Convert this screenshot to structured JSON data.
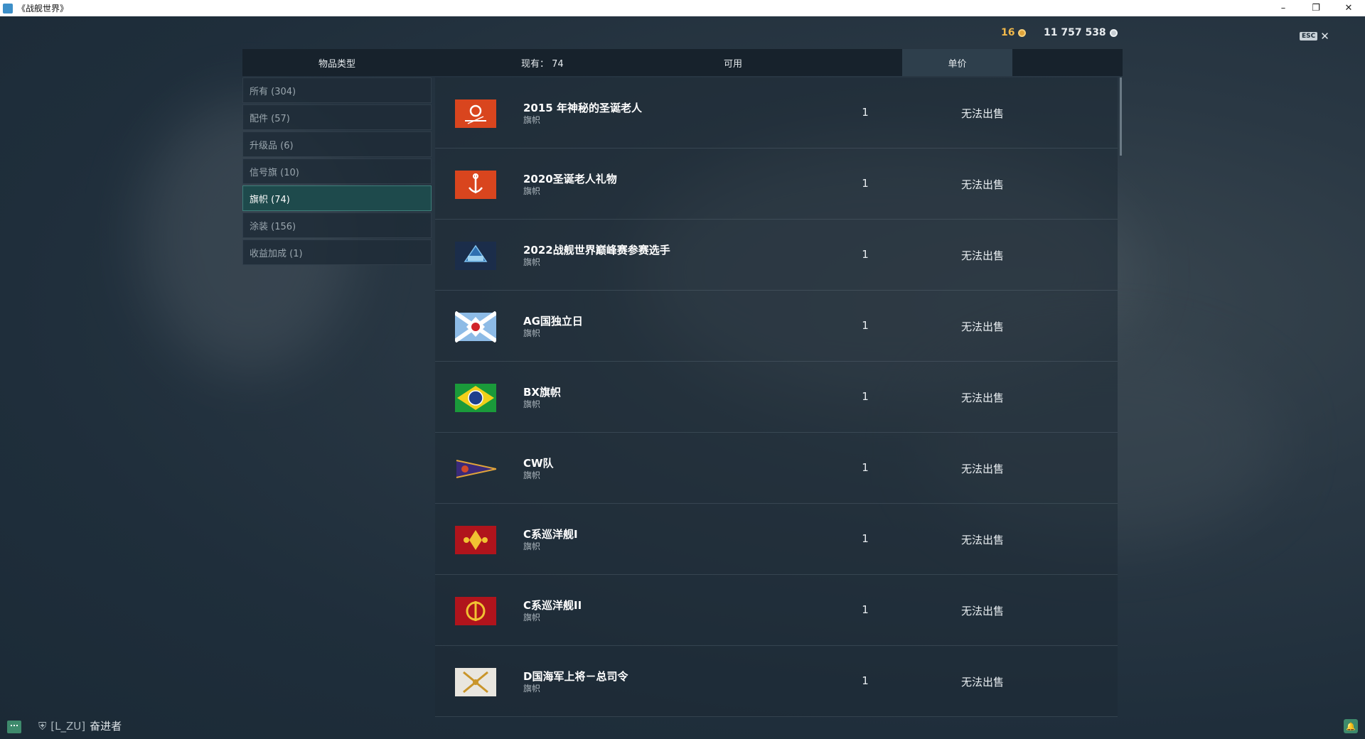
{
  "window": {
    "title": "《战舰世界》",
    "controls": [
      "–",
      "❐",
      "✕"
    ]
  },
  "currencies": [
    {
      "value": "16",
      "icon": "gold-doubloon-icon",
      "color": "#f0b84a"
    },
    {
      "value": "11 757 538",
      "icon": "silver-credits-icon",
      "color": "#e6ebee"
    }
  ],
  "esc": {
    "key": "ESC",
    "close": "✕"
  },
  "header": {
    "type_label": "物品类型",
    "have_label": "现有：  74",
    "available_label": "可用",
    "price_label": "单价"
  },
  "sidebar": {
    "items": [
      {
        "label": "所有 (304)",
        "active": false
      },
      {
        "label": "配件 (57)",
        "active": false
      },
      {
        "label": "升级品 (6)",
        "active": false
      },
      {
        "label": "信号旗 (10)",
        "active": false
      },
      {
        "label": "旗帜 (74)",
        "active": true
      },
      {
        "label": "涂装 (156)",
        "active": false
      },
      {
        "label": "收益加成 (1)",
        "active": false
      }
    ]
  },
  "rows": [
    {
      "name": "2015 年神秘的圣诞老人",
      "category": "旗帜",
      "available": "1",
      "price": "无法出售",
      "flag": "santa-2015-flag-icon",
      "flag_color": "#d9451e"
    },
    {
      "name": "2020圣诞老人礼物",
      "category": "旗帜",
      "available": "1",
      "price": "无法出售",
      "flag": "santa-2020-flag-icon",
      "flag_color": "#d9451e"
    },
    {
      "name": "2022战舰世界巅峰赛参赛选手",
      "category": "旗帜",
      "available": "1",
      "price": "无法出售",
      "flag": "championship-2022-flag-icon",
      "flag_color": "#1b2d4a"
    },
    {
      "name": "AG国独立日",
      "category": "旗帜",
      "available": "1",
      "price": "无法出售",
      "flag": "ag-independence-flag-icon",
      "flag_color": "#8dbbe6"
    },
    {
      "name": "BX旗帜",
      "category": "旗帜",
      "available": "1",
      "price": "无法出售",
      "flag": "bx-flag-icon",
      "flag_color": "#1a9a3a"
    },
    {
      "name": "CW队",
      "category": "旗帜",
      "available": "1",
      "price": "无法出售",
      "flag": "cw-team-pennant-icon",
      "flag_color": "#3a2a7a"
    },
    {
      "name": "C系巡洋舰I",
      "category": "旗帜",
      "available": "1",
      "price": "无法出售",
      "flag": "c-cruiser-i-flag-icon",
      "flag_color": "#b0141c"
    },
    {
      "name": "C系巡洋舰II",
      "category": "旗帜",
      "available": "1",
      "price": "无法出售",
      "flag": "c-cruiser-ii-flag-icon",
      "flag_color": "#b0141c"
    },
    {
      "name": "D国海军上将－总司令",
      "category": "旗帜",
      "available": "1",
      "price": "无法出售",
      "flag": "d-admiral-flag-icon",
      "flag_color": "#e9e6df"
    }
  ],
  "bottom": {
    "clan_tag": "[L_ZU]",
    "player_name": "奋进者"
  }
}
